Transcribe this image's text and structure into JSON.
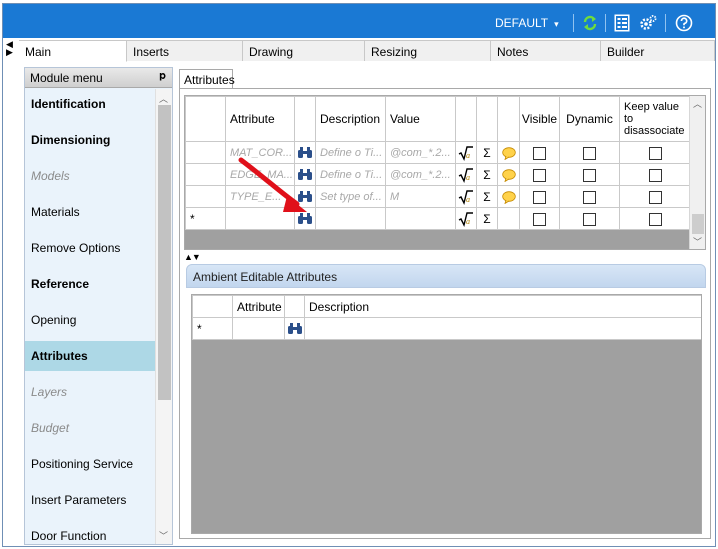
{
  "topbar": {
    "profile_label": "DEFAULT",
    "profile_caret": "▾",
    "icons": [
      "refresh-icon",
      "properties-icon",
      "settings-icon",
      "help-icon"
    ]
  },
  "tabs": [
    {
      "label": "Main",
      "active": true
    },
    {
      "label": "Inserts",
      "active": false
    },
    {
      "label": "Drawing",
      "active": false
    },
    {
      "label": "Resizing",
      "active": false
    },
    {
      "label": "Notes",
      "active": false
    },
    {
      "label": "Builder",
      "active": false
    }
  ],
  "sidebar": {
    "title": "Module menu",
    "pin_glyph": "ᵖ",
    "items": [
      {
        "label": "Identification",
        "style": "bold"
      },
      {
        "label": "Dimensioning",
        "style": "bold"
      },
      {
        "label": "Models",
        "style": "muted"
      },
      {
        "label": "Materials",
        "style": "normal"
      },
      {
        "label": "Remove Options",
        "style": "normal"
      },
      {
        "label": "Reference",
        "style": "bold"
      },
      {
        "label": "Opening",
        "style": "normal"
      },
      {
        "label": "Attributes",
        "style": "active"
      },
      {
        "label": "Layers",
        "style": "muted"
      },
      {
        "label": "Budget",
        "style": "muted"
      },
      {
        "label": "Positioning Service",
        "style": "normal"
      },
      {
        "label": "Insert Parameters",
        "style": "normal"
      },
      {
        "label": "Door Function",
        "style": "normal"
      }
    ]
  },
  "attributes": {
    "tab_label": "Attributes",
    "columns": {
      "attribute": "Attribute",
      "description": "Description",
      "value": "Value",
      "visible": "Visible",
      "dynamic": "Dynamic",
      "keep": "Keep value to disassociate"
    },
    "rows": [
      {
        "attribute": "MAT_COR...",
        "description": "Define o Ti...",
        "value": "@com_*.2..."
      },
      {
        "attribute": "EDGE_MA...",
        "description": "Define o Ti...",
        "value": "@com_*.2..."
      },
      {
        "attribute": "TYPE_E...",
        "description": "Set type of...",
        "value": "M"
      }
    ],
    "new_row_marker": "*",
    "sigma": "Σ",
    "splitter_glyph": "▲▼"
  },
  "ambient": {
    "title": "Ambient Editable Attributes",
    "columns": {
      "attribute": "Attribute",
      "description": "Description"
    },
    "new_row_marker": "*"
  }
}
